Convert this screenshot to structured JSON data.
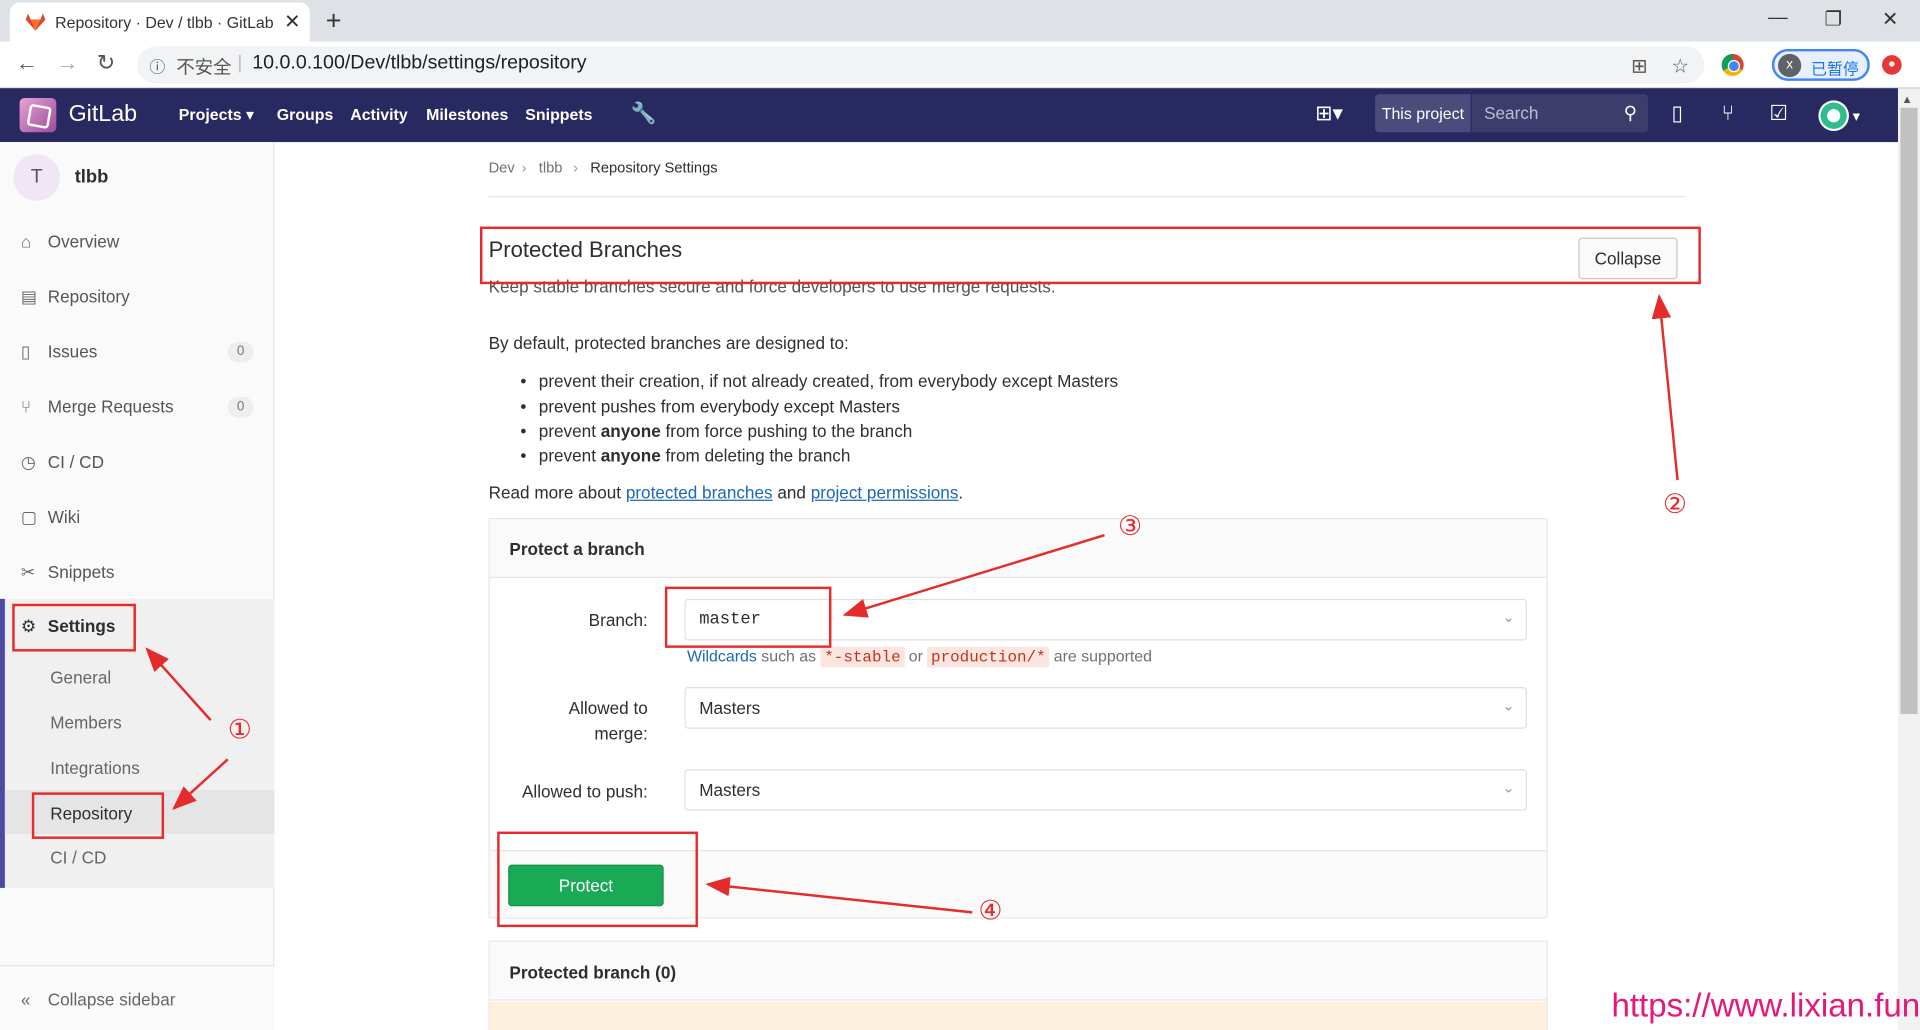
{
  "browser": {
    "tab_title": "Repository · Dev / tlbb · GitLab",
    "tab_close": "✕",
    "new_tab": "+",
    "insecure_label": "不安全",
    "url": "10.0.0.100/Dev/tlbb/settings/repository",
    "profile_initial": "x",
    "profile_label": "已暂停"
  },
  "gitlab": {
    "brand": "GitLab",
    "nav": [
      "Projects ▾",
      "Groups",
      "Activity",
      "Milestones",
      "Snippets"
    ],
    "scope_label": "This project",
    "search_placeholder": "Search"
  },
  "sidebar": {
    "project_initial": "T",
    "project_name": "tlbb",
    "items": [
      {
        "label": "Overview"
      },
      {
        "label": "Repository"
      },
      {
        "label": "Issues",
        "count": "0"
      },
      {
        "label": "Merge Requests",
        "count": "0"
      },
      {
        "label": "CI / CD"
      },
      {
        "label": "Wiki"
      },
      {
        "label": "Snippets"
      }
    ],
    "settings_label": "Settings",
    "settings_sub": [
      "General",
      "Members",
      "Integrations",
      "Repository",
      "CI / CD"
    ],
    "collapse_label": "Collapse sidebar"
  },
  "breadcrumb": [
    "Dev",
    "tlbb",
    "Repository Settings"
  ],
  "section": {
    "title": "Protected Branches",
    "collapse_label": "Collapse",
    "description": "Keep stable branches secure and force developers to use merge requests.",
    "intro": "By default, protected branches are designed to:",
    "bullets": [
      {
        "pre": "prevent their creation, if not already created, from everybody except Masters",
        "bold": "",
        "post": ""
      },
      {
        "pre": "prevent pushes from everybody except Masters",
        "bold": "",
        "post": ""
      },
      {
        "pre": "prevent ",
        "bold": "anyone",
        "post": " from force pushing to the branch"
      },
      {
        "pre": "prevent ",
        "bold": "anyone",
        "post": " from deleting the branch"
      }
    ],
    "read_more_pre": "Read more about ",
    "link1": "protected branches",
    "read_more_mid": " and ",
    "link2": "project permissions",
    "read_more_post": "."
  },
  "protect_form": {
    "title": "Protect a branch",
    "branch_label": "Branch:",
    "branch_value": "master",
    "hint_link": "Wildcards",
    "hint_mid1": " such as ",
    "hint_code1": "*-stable",
    "hint_mid2": " or ",
    "hint_code2": "production/*",
    "hint_post": " are supported",
    "merge_label_1": "Allowed to",
    "merge_label_2": "merge:",
    "merge_value": "Masters",
    "push_label": "Allowed to push:",
    "push_value": "Masters",
    "protect_button": "Protect"
  },
  "protected_list": {
    "title": "Protected branch (0)"
  },
  "annotations": {
    "n1": "①",
    "n2": "②",
    "n3": "③",
    "n4": "④",
    "watermark": "https://www.lixian.fun",
    "color": "#e52b2b"
  }
}
